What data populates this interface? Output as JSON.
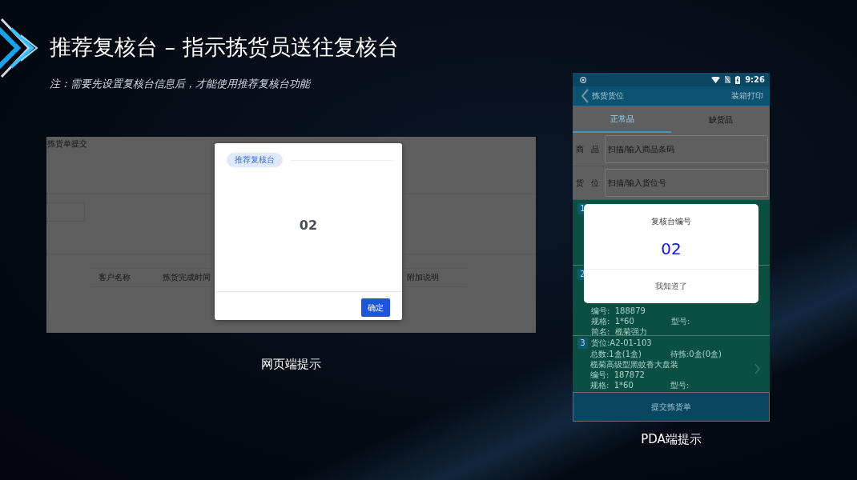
{
  "slide": {
    "title": "推荐复核台 – 指示拣货员送往复核台",
    "note": "注：需要先设置复核台信息后，才能使用推荐复核台功能"
  },
  "web_screen": {
    "page_title": "拣货单提交",
    "columns": [
      "客户名称",
      "拣货完成时间",
      "附加说明"
    ],
    "dialog": {
      "tag": "推荐复核台",
      "value": "02",
      "button": "确定"
    },
    "caption": "网页端提示"
  },
  "pda_screen": {
    "status_bar": {
      "time": "9:26"
    },
    "header": {
      "title": "拣货货位",
      "action": "装箱打印"
    },
    "tabs": [
      {
        "label": "正常品",
        "selected": true
      },
      {
        "label": "缺货品",
        "selected": false
      }
    ],
    "fields": [
      {
        "label": "商 品",
        "placeholder": "扫描/输入商品条码"
      },
      {
        "label": "货 位",
        "placeholder": "扫描/输入货位号"
      }
    ],
    "items": [
      {
        "number": "1"
      },
      {
        "number": "2",
        "rows": [
          [
            "编号:  188879"
          ],
          [
            "规格:  1*60",
            "型号:"
          ],
          [
            "简名:  榄菊强力"
          ]
        ]
      },
      {
        "number": "3",
        "title": "货位:A2-01-103",
        "rows": [
          [
            "总数:1盒(1盒)",
            "待拣:0盒(0盒)"
          ],
          [
            "榄菊高级型黑蚊香大盘装"
          ],
          [
            "编号:  187872"
          ],
          [
            "规格:  1*60",
            "型号:"
          ]
        ],
        "has_arrow": true
      }
    ],
    "dialog": {
      "title": "复核台编号",
      "value": "02",
      "button": "我知道了"
    },
    "submit_button": "提交拣货单",
    "caption": "PDA端提示"
  }
}
